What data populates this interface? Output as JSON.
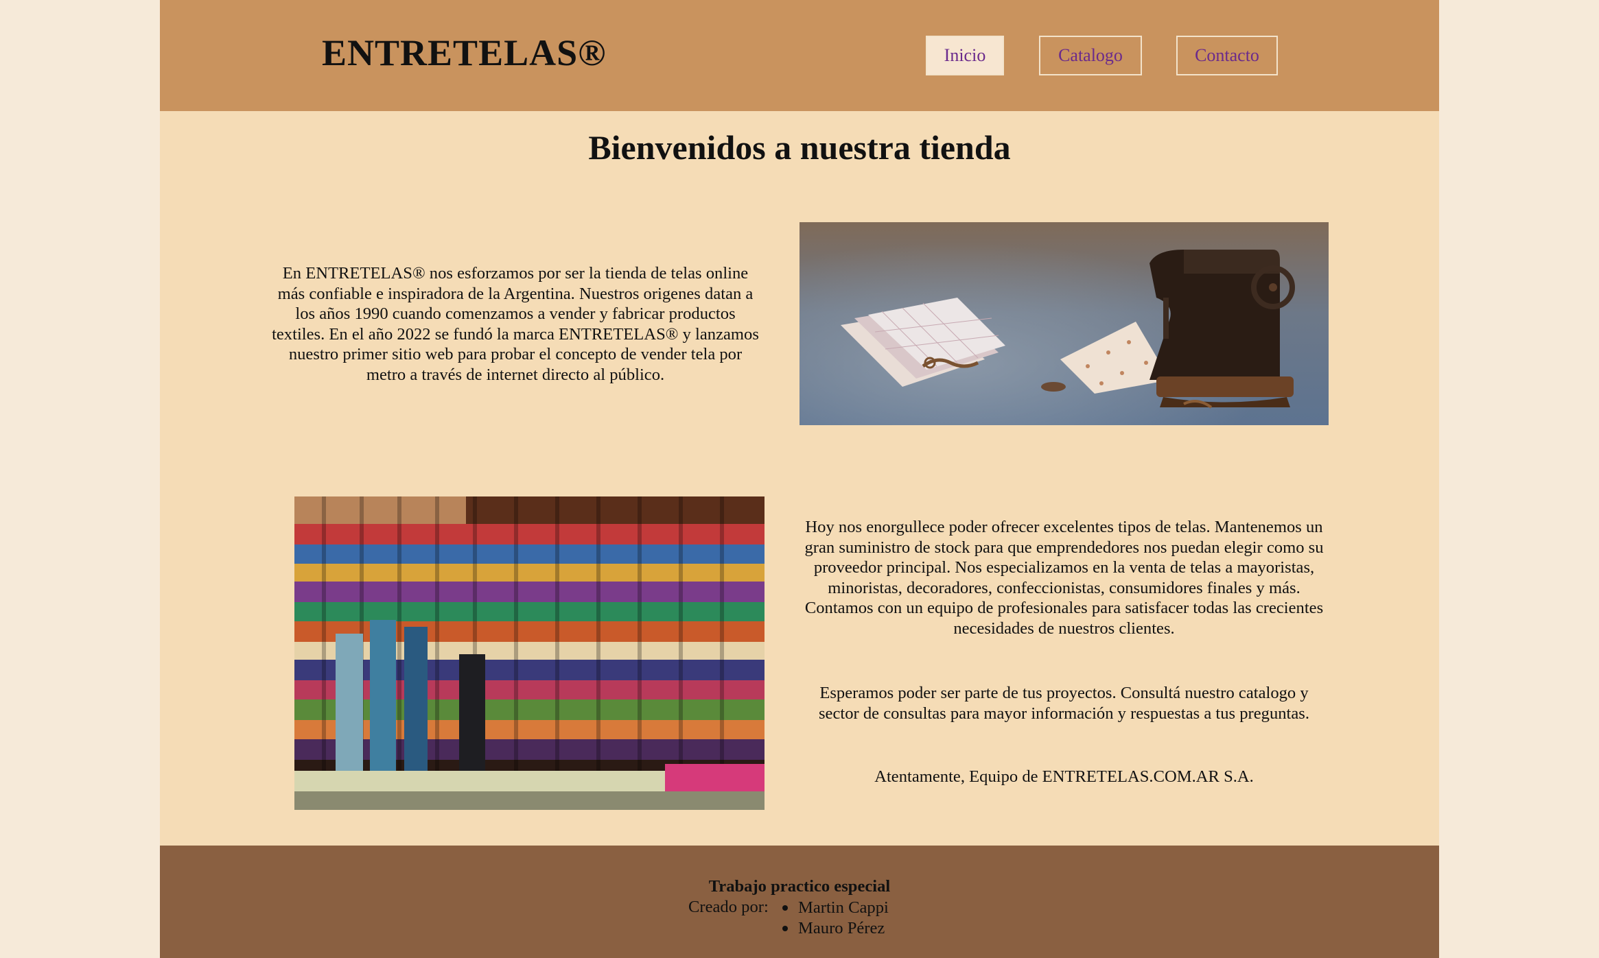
{
  "header": {
    "logo": "ENTRETELAS®",
    "nav": [
      {
        "label": "Inicio",
        "active": true
      },
      {
        "label": "Catalogo",
        "active": false
      },
      {
        "label": "Contacto",
        "active": false
      }
    ]
  },
  "main": {
    "title": "Bienvenidos a nuestra tienda",
    "intro": "En ENTRETELAS® nos esforzamos por ser la tienda de telas online más confiable e inspiradora de la Argentina. Nuestros origenes datan a los años 1990 cuando comenzamos a vender y fabricar productos textiles. En el año 2022 se fundó la marca ENTRETELAS® y lanzamos nuestro primer sitio web para probar el concepto de vender tela por metro a través de internet directo al público.",
    "offer": "Hoy nos enorgullece poder ofrecer excelentes tipos de telas. Mantenemos un gran suministro de stock para que emprendedores nos puedan elegir como su proveedor principal. Nos especializamos en la venta de telas a mayoristas, minoristas, decoradores, confeccionistas, consumidores finales y más. Contamos con un equipo de profesionales para satisfacer todas las crecientes necesidades de nuestros clientes.",
    "hope": "Esperamos poder ser parte de tus proyectos. Consultá nuestro catalogo y sector de consultas para mayor información y respuestas a tus preguntas.",
    "signature": "Atentamente, Equipo de ENTRETELAS.COM.AR S.A."
  },
  "footer": {
    "title": "Trabajo practico especial",
    "created_by": "Creado por:",
    "authors": [
      "Martin Cappi",
      "Mauro Pérez"
    ]
  },
  "colors": {
    "header_bg": "#c9935e",
    "content_bg": "#f5dcb6",
    "footer_bg": "#8a6041",
    "nav_text": "#6a2a8c",
    "outer_bg": "#f6ead9"
  }
}
